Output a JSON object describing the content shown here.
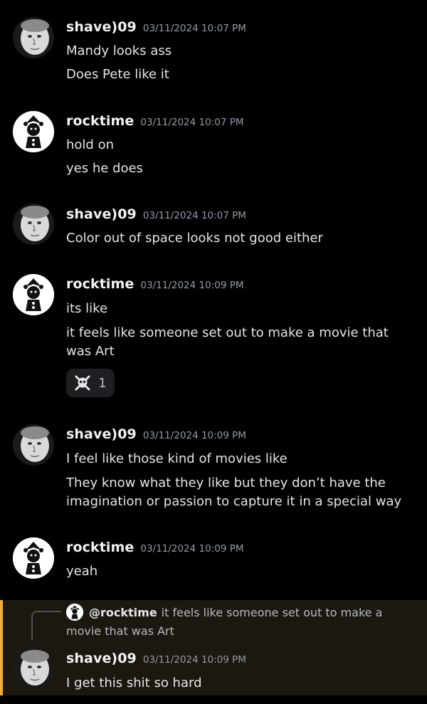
{
  "messages": [
    {
      "author": "shave)09",
      "timestamp": "03/11/2024 10:07 PM",
      "avatar": "grayscale-face",
      "lines": [
        "Mandy looks ass",
        "Does Pete like it"
      ]
    },
    {
      "author": "rocktime",
      "timestamp": "03/11/2024 10:07 PM",
      "avatar": "jester-clown",
      "lines": [
        "hold on",
        "yes he does"
      ]
    },
    {
      "author": "shave)09",
      "timestamp": "03/11/2024 10:07 PM",
      "avatar": "grayscale-face",
      "lines": [
        "Color out of space looks not good either"
      ]
    },
    {
      "author": "rocktime",
      "timestamp": "03/11/2024 10:09 PM",
      "avatar": "jester-clown",
      "lines": [
        "its like",
        "it feels like someone set out to make a movie that was Art"
      ],
      "reaction": {
        "emoji": "skull-and-crossbones",
        "count": "1"
      }
    },
    {
      "author": "shave)09",
      "timestamp": "03/11/2024 10:09 PM",
      "avatar": "grayscale-face",
      "lines": [
        "I feel like those kind of movies like",
        "They know what they like but they don’t have the imagination or passion to capture it in a special way"
      ]
    },
    {
      "author": "rocktime",
      "timestamp": "03/11/2024 10:09 PM",
      "avatar": "jester-clown",
      "lines": [
        "yeah"
      ]
    },
    {
      "author": "shave)09",
      "timestamp": "03/11/2024 10:09 PM",
      "avatar": "grayscale-face",
      "lines": [
        "I get this shit so hard"
      ],
      "reply_to": {
        "mention": "@rocktime",
        "text": "it feels like someone set out to make a movie that was Art"
      }
    }
  ],
  "colors": {
    "background": "#000000",
    "reply_highlight": "#1c1810",
    "reply_accent": "#f0b232",
    "username": "#f2f3f5",
    "timestamp": "#949ba4",
    "message_text": "#e3e5e8"
  }
}
